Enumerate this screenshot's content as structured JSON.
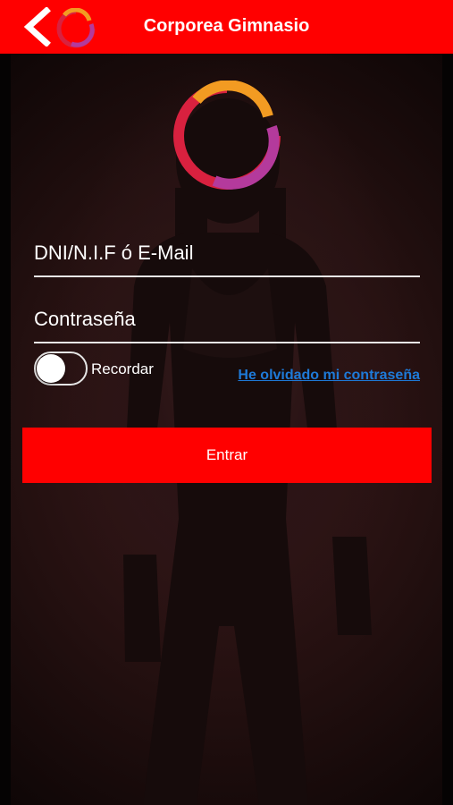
{
  "header": {
    "title": "Corporea Gimnasio",
    "back_icon": "chevron-left-icon",
    "logo_icon": "brand-ring-logo-icon",
    "background_color": "#ff0000"
  },
  "login": {
    "user_placeholder": "DNI/N.I.F ó E-Mail",
    "user_value": "",
    "password_placeholder": "Contraseña",
    "password_value": "",
    "remember_label": "Recordar",
    "remember_on": false,
    "forgot_link": "He olvidado mi contraseña",
    "submit_label": "Entrar"
  },
  "colors": {
    "accent_red": "#ff0000",
    "link_blue": "#1e7ad8",
    "logo_ring_colors": [
      "#d8213f",
      "#f29b22",
      "#b43a9c"
    ]
  }
}
